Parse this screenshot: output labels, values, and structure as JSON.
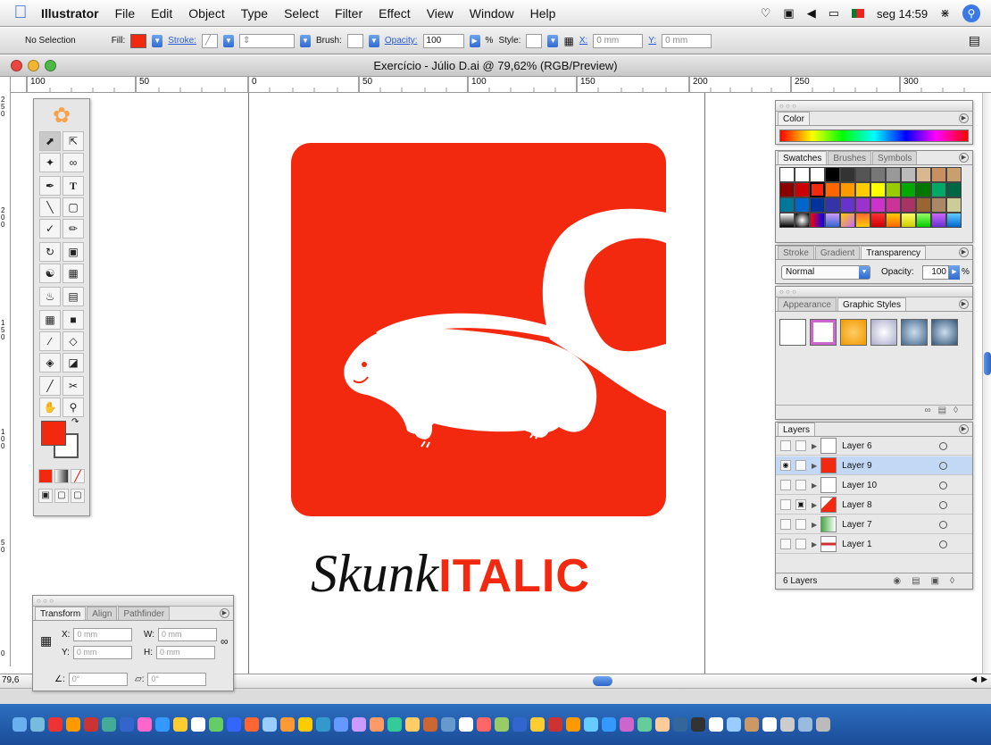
{
  "menubar": {
    "app": "Illustrator",
    "items": [
      "File",
      "Edit",
      "Object",
      "Type",
      "Select",
      "Filter",
      "Effect",
      "View",
      "Window",
      "Help"
    ],
    "clock": "seg 14:59"
  },
  "control": {
    "selection": "No Selection",
    "fill_label": "Fill:",
    "stroke_label": "Stroke:",
    "brush_label": "Brush:",
    "opacity_label": "Opacity:",
    "opacity_value": "100",
    "percent": "%",
    "style_label": "Style:",
    "x_label": "X:",
    "x_value": "0 mm",
    "y_label": "Y:",
    "y_value": "0 mm"
  },
  "document": {
    "title": "Exercício - Júlio D.ai @ 79,62% (RGB/Preview)",
    "zoom": "79,6",
    "ruler_h": [
      "100",
      "50",
      "0",
      "50",
      "100",
      "150",
      "200",
      "250",
      "300"
    ],
    "ruler_v": [
      "250",
      "200",
      "150",
      "100",
      "50",
      "0"
    ]
  },
  "artwork": {
    "word_black": "Skunk",
    "word_red": "ITALIC"
  },
  "panels": {
    "color": {
      "tab": "Color"
    },
    "swatches": {
      "tabs": [
        "Swatches",
        "Brushes",
        "Symbols"
      ]
    },
    "transparency": {
      "tabs": [
        "Stroke",
        "Gradient",
        "Transparency"
      ],
      "mode": "Normal",
      "opacity_label": "Opacity:",
      "opacity_value": "100",
      "percent": "%"
    },
    "appearance": {
      "tabs": [
        "Appearance",
        "Graphic Styles"
      ]
    },
    "layers": {
      "tab": "Layers",
      "rows": [
        "Layer 6",
        "Layer 9",
        "Layer 10",
        "Layer 8",
        "Layer 7",
        "Layer 1"
      ],
      "count": "6 Layers"
    },
    "transform": {
      "tabs": [
        "Transform",
        "Align",
        "Pathfinder"
      ],
      "x_label": "X:",
      "x_value": "0 mm",
      "y_label": "Y:",
      "y_value": "0 mm",
      "w_label": "W:",
      "w_value": "0 mm",
      "h_label": "H:",
      "h_value": "0 mm",
      "angle_value": "0°",
      "shear_value": "0°"
    }
  },
  "colors": {
    "accent_red": "#f2290f",
    "selection_blue": "#c2d8f4"
  },
  "icons": {
    "apple": "apple-icon",
    "spotlight": "search-icon"
  }
}
